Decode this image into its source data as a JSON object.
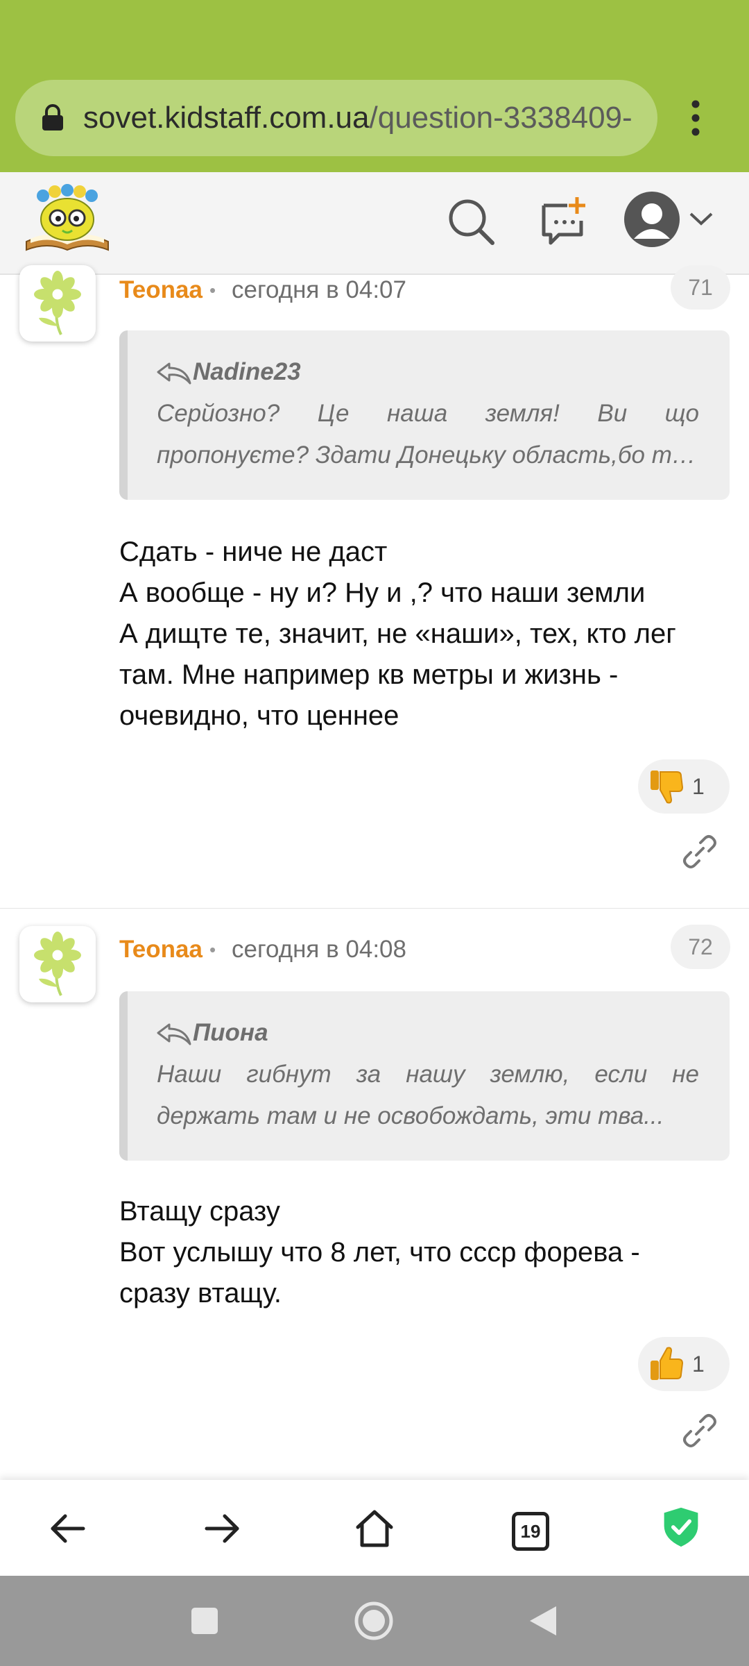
{
  "browser": {
    "url_domain": "sovet.kidstaff.com.ua",
    "url_path": "/question-3338409-",
    "tab_count": "19"
  },
  "header": {
    "logo": "kidstaff-logo",
    "icons": [
      "search-icon",
      "new-question-icon",
      "profile-avatar-icon",
      "chevron-down-icon"
    ]
  },
  "comments": [
    {
      "author": "Teonaa",
      "time": "сегодня в 04:07",
      "number": "71",
      "quote": {
        "author": "Nadine23",
        "lines": [
          "Серйозно? Це наша земля! Ви що",
          "пропонуєте? Здати Донецьку область,бо та..."
        ]
      },
      "body": [
        "Сдать - ниче не даст",
        "А вообще - ну и? Ну и ,? что наши земли",
        "А дищте те, значит, не «наши», тех, кто лег",
        "там. Мне например кв метры и жизнь -",
        "очевидно, что ценнее"
      ],
      "reaction": {
        "icon": "thumbs-down-icon",
        "count": "1"
      }
    },
    {
      "author": "Teonaa",
      "time": "сегодня в 04:08",
      "number": "72",
      "quote": {
        "author": "Пиона",
        "lines": [
          "Наши гибнут за нашу землю, если не",
          "держать там и не освобождать, эти тва..."
        ]
      },
      "body": [
        "Втащу сразу",
        "Вот услышу что 8 лет, что ссср форева -",
        "сразу втащу."
      ],
      "reaction": {
        "icon": "thumbs-up-icon",
        "count": "1"
      }
    }
  ],
  "colors": {
    "browser_bar": "#9dc143",
    "author": "#e88a1a",
    "shield": "#2ecc71"
  }
}
